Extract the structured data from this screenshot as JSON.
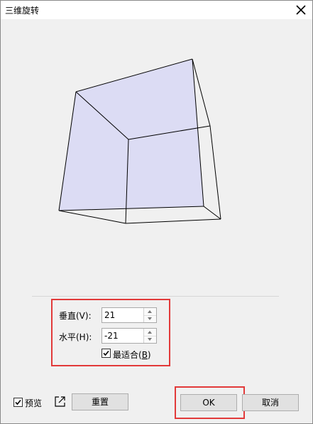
{
  "window": {
    "title": "三维旋转"
  },
  "icons": {
    "close": "close-icon",
    "external": "external-link-icon",
    "check": "checkmark-icon"
  },
  "rotation": {
    "vertical_label": "垂直(V):",
    "vertical_value": "21",
    "horizontal_label": "水平(H):",
    "horizontal_value": "-21",
    "best_fit_label_pre": "最适合(",
    "best_fit_key": "B",
    "best_fit_label_post": ")",
    "best_fit_checked": true
  },
  "footer": {
    "preview_label": "预览",
    "preview_checked": true,
    "reset_label": "重置",
    "ok_label": "OK",
    "cancel_label": "取消"
  },
  "colors": {
    "highlight_red": "#e23a3a",
    "face_fill": "#dcdcf4"
  }
}
